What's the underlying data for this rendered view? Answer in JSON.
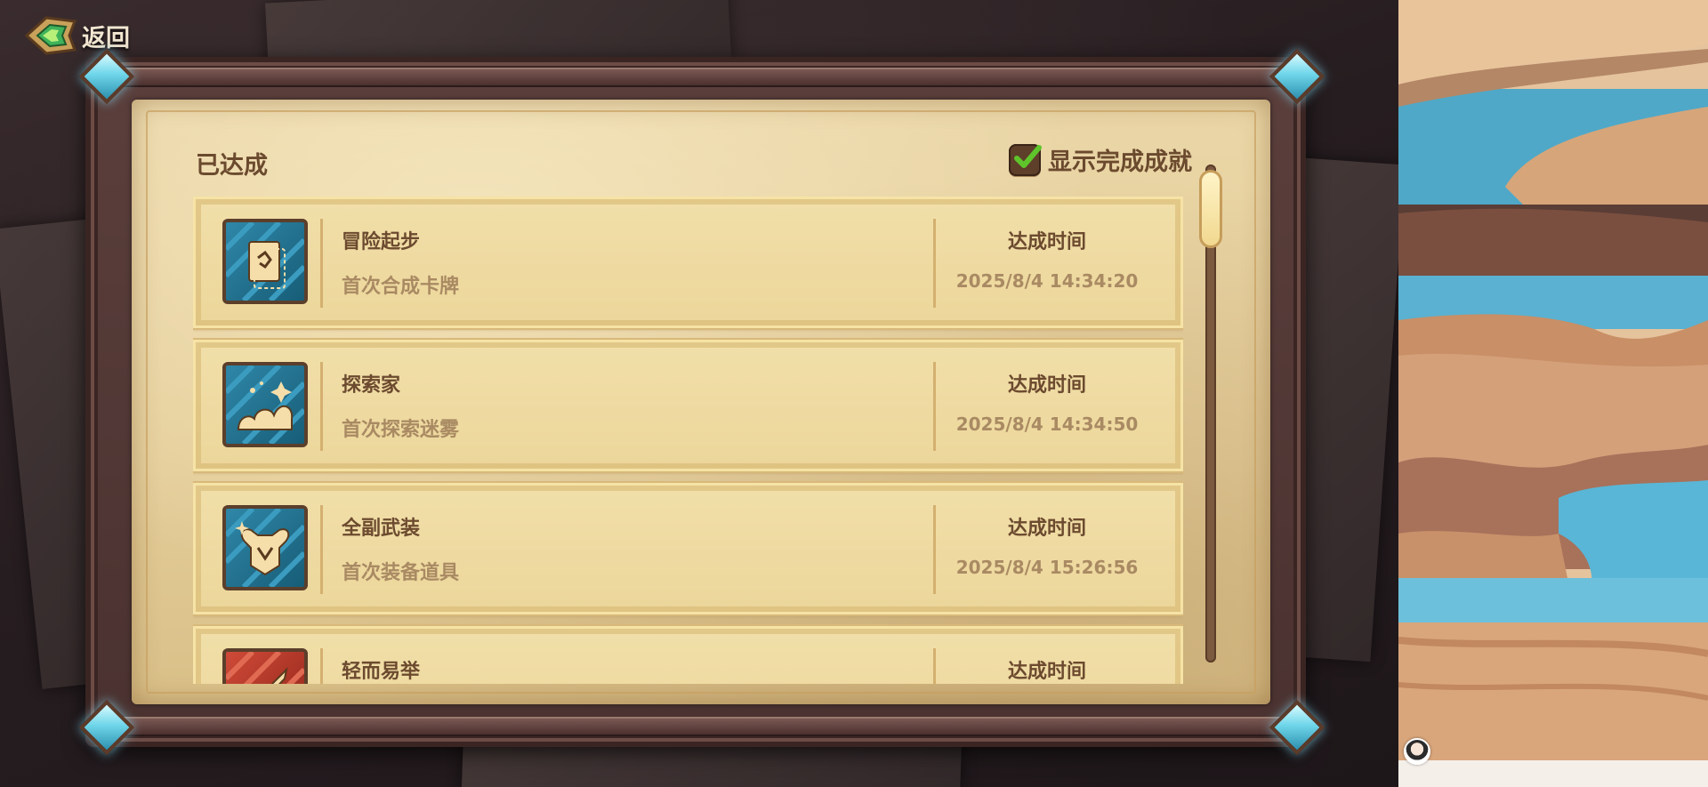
{
  "back": {
    "label": "返回"
  },
  "panel": {
    "title": "已达成",
    "toggle_label": "显示完成成就",
    "toggle_checked": true
  },
  "achievements": [
    {
      "name": "冒险起步",
      "desc": "首次合成卡牌",
      "time_label": "达成时间",
      "time": "2025/8/4 14:34:20",
      "icon": "card-icon",
      "color": "#1f6f8b"
    },
    {
      "name": "探索家",
      "desc": "首次探索迷雾",
      "time_label": "达成时间",
      "time": "2025/8/4 14:34:50",
      "icon": "fog-icon",
      "color": "#1f6f8b"
    },
    {
      "name": "全副武装",
      "desc": "首次装备道具",
      "time_label": "达成时间",
      "time": "2025/8/4 15:26:56",
      "icon": "armor-icon",
      "color": "#1f6f8b"
    },
    {
      "name": "轻而易举",
      "desc": "",
      "time_label": "达成时间",
      "time": "",
      "icon": "sword-icon",
      "color": "#b6352a"
    }
  ],
  "colors": {
    "parchment": "#e9d4a3",
    "text_dark": "#6c4a2f",
    "text_light": "#a98a63",
    "check_green": "#5ec52b",
    "icon_blue": "#1f6f8b",
    "icon_red": "#b6352a"
  }
}
